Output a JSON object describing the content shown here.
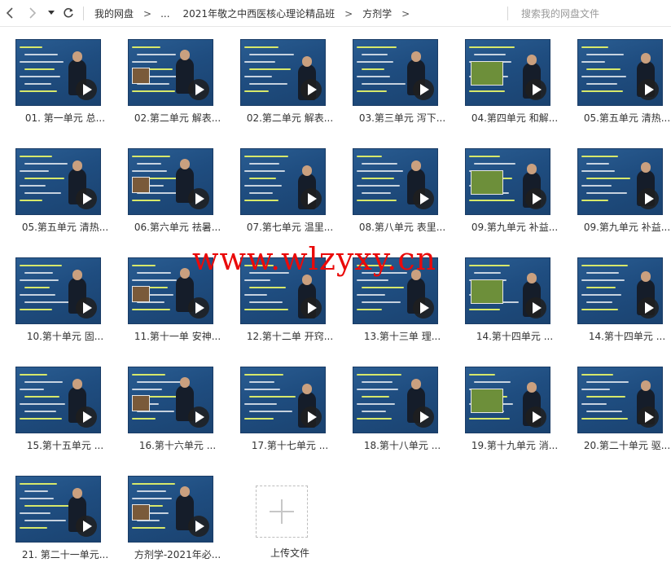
{
  "toolbar": {
    "breadcrumbs": [
      "我的网盘",
      "...",
      "2021年敬之中西医核心理论精品班",
      "方剂学"
    ],
    "separator": ">",
    "search_placeholder": "搜索我的网盘文件",
    "icons": {
      "back": "chevron-left-icon",
      "forward": "chevron-right-icon",
      "dropdown": "caret-down-icon",
      "refresh": "refresh-icon"
    }
  },
  "files": [
    {
      "name": "01. 第一单元 总..."
    },
    {
      "name": "02.第二单元 解表..."
    },
    {
      "name": "02.第二单元 解表..."
    },
    {
      "name": "03.第三单元 泻下..."
    },
    {
      "name": "04.第四单元 和解..."
    },
    {
      "name": "05.第五单元 清热..."
    },
    {
      "name": "05.第五单元 清热..."
    },
    {
      "name": "06.第六单元 祛暑..."
    },
    {
      "name": "07.第七单元 温里..."
    },
    {
      "name": "08.第八单元 表里..."
    },
    {
      "name": "09.第九单元 补益..."
    },
    {
      "name": "09.第九单元 补益..."
    },
    {
      "name": "10.第十单元  固..."
    },
    {
      "name": "11.第十一单 安神..."
    },
    {
      "name": "12.第十二单 开窍..."
    },
    {
      "name": "13.第十三单  理..."
    },
    {
      "name": "14.第十四单元  ..."
    },
    {
      "name": "14.第十四单元  ..."
    },
    {
      "name": "15.第十五单元  ..."
    },
    {
      "name": "16.第十六单元  ..."
    },
    {
      "name": "17.第十七单元  ..."
    },
    {
      "name": "18.第十八单元  ..."
    },
    {
      "name": "19.第十九单元 消..."
    },
    {
      "name": "20.第二十单元 驱..."
    },
    {
      "name": "21. 第二十一单元..."
    },
    {
      "name": "方剂学-2021年必..."
    }
  ],
  "upload": {
    "label": "上传文件"
  },
  "watermark": "www.wlzyxy.cn",
  "colors": {
    "thumb_bg": "#1f4d80",
    "watermark": "#ea0a0a",
    "highlight": "#d7e86a"
  }
}
